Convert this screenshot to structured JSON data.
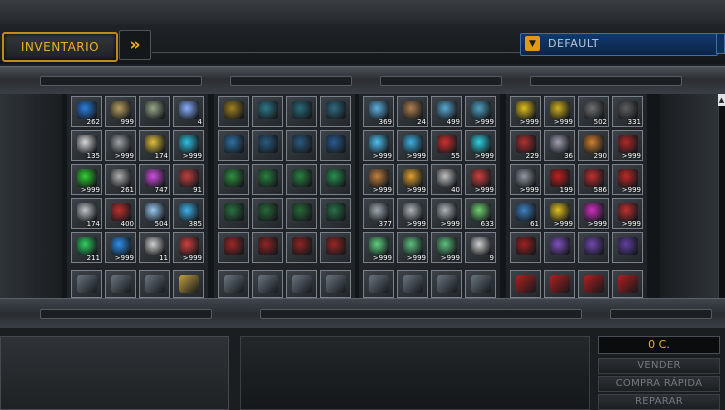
{
  "header": {
    "tab_label": "INVENTARIO",
    "expand_icon": "double-chevron-right-icon",
    "filter": {
      "selected": "DEFAULT",
      "arrow_icon": "dropdown-triangle-icon"
    }
  },
  "inventory": {
    "groups": [
      {
        "name": "consumables",
        "slots": [
          {
            "icon": "blue-crystal-icon",
            "color": "#2a7fe0",
            "count": "262"
          },
          {
            "icon": "drone-icon",
            "color": "#b8a060",
            "count": "999"
          },
          {
            "icon": "map-icon",
            "color": "#9aa88a",
            "count": ""
          },
          {
            "icon": "spark-icon",
            "color": "#8ab0ff",
            "count": "4"
          },
          {
            "icon": "orb-icon",
            "color": "#d8d8d8",
            "count": "135"
          },
          {
            "icon": "device-icon",
            "color": "#a0a4a8",
            "count": ">999"
          },
          {
            "icon": "gold-cube-icon",
            "color": "#e0c040",
            "count": "174"
          },
          {
            "icon": "cyan-module-icon",
            "color": "#30c0e0",
            "count": ">999"
          },
          {
            "icon": "green-triangle-icon",
            "color": "#30d030",
            "count": ">999"
          },
          {
            "icon": "claw-icon",
            "color": "#b0b0b0",
            "count": "261"
          },
          {
            "icon": "purple-shard-icon",
            "color": "#d050e0",
            "count": "747"
          },
          {
            "icon": "red-cell-icon",
            "color": "#c04040",
            "count": "91"
          },
          {
            "icon": "wing-icon",
            "color": "#c0c4c8",
            "count": "174"
          },
          {
            "icon": "red-turret-icon",
            "color": "#c03030",
            "count": "400"
          },
          {
            "icon": "ice-cluster-icon",
            "color": "#9ac8f0",
            "count": "504"
          },
          {
            "icon": "cyan-cube-icon",
            "color": "#40b0e8",
            "count": "385"
          },
          {
            "icon": "green-gem-icon",
            "color": "#30d060",
            "count": "211"
          },
          {
            "icon": "blue-diamond-icon",
            "color": "#3090f0",
            "count": ">999"
          },
          {
            "icon": "blade-icon",
            "color": "#d0d0d0",
            "count": "11"
          },
          {
            "icon": "red-orb-icon",
            "color": "#d04040",
            "count": ">999"
          }
        ]
      },
      {
        "name": "modules",
        "slots": [
          {
            "icon": "yellow-frame-icon",
            "color": "#a08020",
            "count": ""
          },
          {
            "icon": "teal-chest-icon",
            "color": "#307888",
            "count": ""
          },
          {
            "icon": "teal-chest-icon",
            "color": "#2a6a7a",
            "count": ""
          },
          {
            "icon": "teal-turret-icon",
            "color": "#306a80",
            "count": ""
          },
          {
            "icon": "blue-frame-icon",
            "color": "#3070a0",
            "count": ""
          },
          {
            "icon": "blue-chest-icon",
            "color": "#2a5a80",
            "count": ""
          },
          {
            "icon": "blue-chest-icon",
            "color": "#2a5a80",
            "count": ""
          },
          {
            "icon": "blue-turret-icon",
            "color": "#2a5a90",
            "count": ""
          },
          {
            "icon": "green-frame-icon",
            "color": "#309040",
            "count": ""
          },
          {
            "icon": "green-chest-icon",
            "color": "#2a8040",
            "count": ""
          },
          {
            "icon": "green-chest-icon",
            "color": "#2a8040",
            "count": ""
          },
          {
            "icon": "green-turret-icon",
            "color": "#2a9050",
            "count": ""
          },
          {
            "icon": "green-frame-icon",
            "color": "#2a7040",
            "count": ""
          },
          {
            "icon": "green-chest-icon",
            "color": "#286838",
            "count": ""
          },
          {
            "icon": "green-chest-icon",
            "color": "#286838",
            "count": ""
          },
          {
            "icon": "green-turret-icon",
            "color": "#287048",
            "count": ""
          },
          {
            "icon": "red-frame-icon",
            "color": "#a02828",
            "count": ""
          },
          {
            "icon": "red-chest-icon",
            "color": "#902424",
            "count": ""
          },
          {
            "icon": "red-chest-icon",
            "color": "#902424",
            "count": ""
          },
          {
            "icon": "red-turret-icon",
            "color": "#9a2626",
            "count": ""
          }
        ]
      },
      {
        "name": "weapons",
        "slots": [
          {
            "icon": "laser-icon",
            "color": "#60b0e0",
            "count": "369"
          },
          {
            "icon": "rocket-icon",
            "color": "#b08050",
            "count": "24"
          },
          {
            "icon": "helmet-icon",
            "color": "#5aa8d0",
            "count": "499"
          },
          {
            "icon": "cannon-icon",
            "color": "#50a0c0",
            "count": ">999"
          },
          {
            "icon": "beam-icon",
            "color": "#50c0f0",
            "count": ">999"
          },
          {
            "icon": "beam-icon",
            "color": "#40b0e0",
            "count": ">999"
          },
          {
            "icon": "red-mine-icon",
            "color": "#d03030",
            "count": "55"
          },
          {
            "icon": "cyan-gate-icon",
            "color": "#30d0e0",
            "count": ">999"
          },
          {
            "icon": "crate-icon",
            "color": "#c08040",
            "count": ">999"
          },
          {
            "icon": "orange-beam-icon",
            "color": "#e0a030",
            "count": ">999"
          },
          {
            "icon": "spike-icon",
            "color": "#c0c0c0",
            "count": "40"
          },
          {
            "icon": "red-cannon-icon",
            "color": "#d04040",
            "count": ">999"
          },
          {
            "icon": "gun-icon",
            "color": "#a0a8b0",
            "count": "377"
          },
          {
            "icon": "gun-icon",
            "color": "#b0b4b8",
            "count": ">999"
          },
          {
            "icon": "gun-icon",
            "color": "#b0b4b8",
            "count": ">999"
          },
          {
            "icon": "plasma-icon",
            "color": "#70d070",
            "count": "633"
          },
          {
            "icon": "green-launcher-icon",
            "color": "#60d080",
            "count": ">999"
          },
          {
            "icon": "green-launcher-icon",
            "color": "#60c080",
            "count": ">999"
          },
          {
            "icon": "green-launcher-icon",
            "color": "#60c080",
            "count": ">999"
          },
          {
            "icon": "rod-icon",
            "color": "#d0d0d0",
            "count": "9"
          }
        ]
      },
      {
        "name": "drones",
        "slots": [
          {
            "icon": "yellow-box-icon",
            "color": "#e0c020",
            "count": ">999"
          },
          {
            "icon": "yellow-box-icon",
            "color": "#d0b020",
            "count": ">999"
          },
          {
            "icon": "dark-crate-icon",
            "color": "#707070",
            "count": "502"
          },
          {
            "icon": "dark-crate-icon",
            "color": "#606060",
            "count": "331"
          },
          {
            "icon": "red-crate-icon",
            "color": "#b03030",
            "count": "229"
          },
          {
            "icon": "ship-icon",
            "color": "#a0a0b0",
            "count": "36"
          },
          {
            "icon": "orange-unit-icon",
            "color": "#d08030",
            "count": "290"
          },
          {
            "icon": "red-unit-icon",
            "color": "#b02828",
            "count": ">999"
          },
          {
            "icon": "gray-drone-icon",
            "color": "#9098a0",
            "count": ">999"
          },
          {
            "icon": "red-x-icon",
            "color": "#c02020",
            "count": "199"
          },
          {
            "icon": "red-spiral-icon",
            "color": "#c03030",
            "count": "586"
          },
          {
            "icon": "red-bolt-icon",
            "color": "#c02828",
            "count": ">999"
          },
          {
            "icon": "blue-ship-icon",
            "color": "#4080c0",
            "count": "61"
          },
          {
            "icon": "yellow-dots-icon",
            "color": "#e0c020",
            "count": ">999"
          },
          {
            "icon": "magenta-box-icon",
            "color": "#d030c0",
            "count": ">999"
          },
          {
            "icon": "red-wrench-icon",
            "color": "#c03030",
            "count": ">999"
          },
          {
            "icon": "red-bomb-icon",
            "color": "#a02020",
            "count": ""
          },
          {
            "icon": "purple-blade-icon",
            "color": "#8050c0",
            "count": ""
          },
          {
            "icon": "purple-blade-icon",
            "color": "#7048b0",
            "count": ""
          },
          {
            "icon": "purple-blade-icon",
            "color": "#6040a0",
            "count": ""
          }
        ]
      }
    ],
    "peek_row": [
      [
        "gun-icon",
        "gun-icon",
        "gun-icon",
        "gold-gun-icon"
      ],
      [
        "rail-icon",
        "rail-icon",
        "rail-icon",
        "rail-icon"
      ],
      [
        "rail-icon",
        "rail-icon",
        "rail-icon",
        "rail-icon"
      ],
      [
        "red-blade-icon",
        "red-blade-icon",
        "red-blade-icon",
        "red-blade-icon"
      ]
    ]
  },
  "footer": {
    "credits": "0 C.",
    "sell_button": "VENDER",
    "quick_buy_button": "COMPRA RÁPIDA",
    "repair_button": "REPARAR"
  }
}
